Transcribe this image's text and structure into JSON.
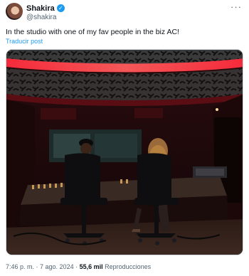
{
  "author": {
    "display_name": "Shakira",
    "handle": "@shakira"
  },
  "tweet": {
    "text": "In the studio with one of my fav people in the biz AC!",
    "translate_label": "Traducir post"
  },
  "meta": {
    "time": "7:46 p. m.",
    "separator": " · ",
    "date": "7 ago. 2024",
    "views_count": "55,6 mil",
    "views_label": "Reproducciones"
  },
  "icons": {
    "verified": "verified-badge-icon",
    "more": "more-options-icon"
  },
  "colors": {
    "accent": "#1d9bf0",
    "secondary_text": "#536471",
    "studio_light": "#e8223a"
  }
}
